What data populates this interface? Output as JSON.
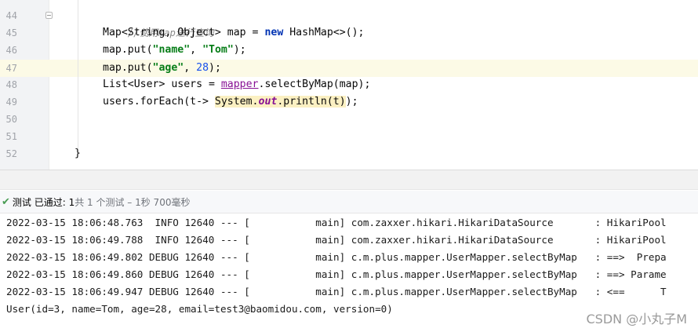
{
  "editor": {
    "line_numbers": [
      "44",
      "45",
      "46",
      "47",
      "48",
      "49",
      "50",
      "51",
      "52"
    ],
    "lines": {
      "l44_comment": "//使用map进行查询",
      "l45_a": "Map<String, Object> map = ",
      "l45_kw": "new",
      "l45_b": " HashMap<>();",
      "l46_a": "map.put(",
      "l46_str1": "\"name\"",
      "l46_b": ", ",
      "l46_str2": "\"Tom\"",
      "l46_c": ");",
      "l47_a": "map.put(",
      "l47_str": "\"age\"",
      "l47_b": ", ",
      "l47_num": "28",
      "l47_c": ");",
      "l48_a": "List<User> users = ",
      "l48_field": "mapper",
      "l48_b": ".selectByMap(map);",
      "l49_a": "users.forEach(t-> ",
      "l49_sys": "System.",
      "l49_out": "out",
      "l49_b": ".println(t)",
      "l49_c": ");",
      "l52_brace": "}"
    }
  },
  "test_status": {
    "check_icon": "check-icon",
    "label": "测试 已通过: 1",
    "detail": "共 1 个测试 – 1秒 700毫秒"
  },
  "console": {
    "lines": [
      "2022-03-15 18:06:48.763  INFO 12640 --- [           main] com.zaxxer.hikari.HikariDataSource       : HikariPool",
      "2022-03-15 18:06:49.788  INFO 12640 --- [           main] com.zaxxer.hikari.HikariDataSource       : HikariPool",
      "2022-03-15 18:06:49.802 DEBUG 12640 --- [           main] c.m.plus.mapper.UserMapper.selectByMap   : ==>  Prepa",
      "2022-03-15 18:06:49.860 DEBUG 12640 --- [           main] c.m.plus.mapper.UserMapper.selectByMap   : ==> Parame",
      "2022-03-15 18:06:49.947 DEBUG 12640 --- [           main] c.m.plus.mapper.UserMapper.selectByMap   : <==      T",
      "User(id=3, name=Tom, age=28, email=test3@baomidou.com, version=0)"
    ]
  },
  "watermark": "CSDN @小丸子M"
}
